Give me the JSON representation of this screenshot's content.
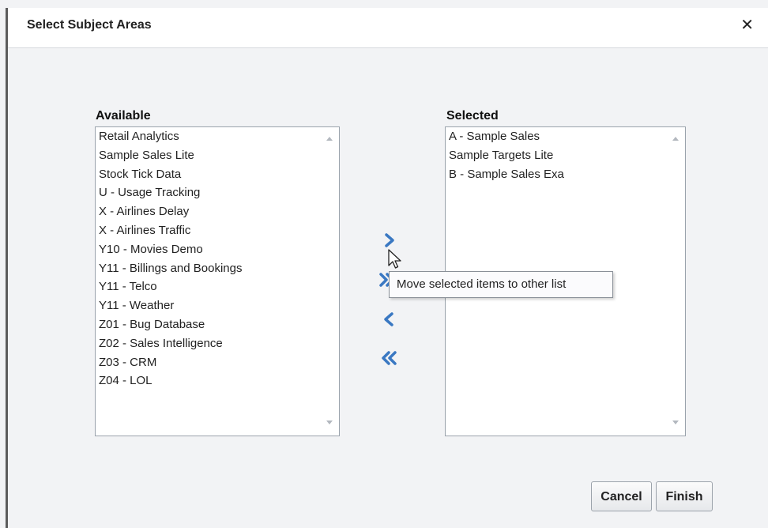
{
  "dialog": {
    "title": "Select Subject Areas",
    "close_glyph": "✕"
  },
  "available": {
    "label": "Available",
    "items": [
      "Retail Analytics",
      "Sample Sales Lite",
      "Stock Tick Data",
      "U - Usage Tracking",
      "X - Airlines Delay",
      "X - Airlines Traffic",
      "Y10 - Movies Demo",
      "Y11 - Billings and Bookings",
      "Y11 - Telco",
      "Y11 - Weather",
      "Z01 - Bug Database",
      "Z02 - Sales Intelligence",
      "Z03 - CRM",
      "Z04 - LOL"
    ]
  },
  "selected": {
    "label": "Selected",
    "items": [
      "A - Sample Sales",
      "Sample Targets Lite",
      "B - Sample Sales Exa"
    ]
  },
  "movers": {
    "tooltip": "Move selected items to other list",
    "icon_color": "#3a78c2",
    "icons": [
      "chevron-right-icon",
      "double-chevron-right-icon",
      "chevron-left-icon",
      "double-chevron-left-icon"
    ]
  },
  "buttons": {
    "cancel": "Cancel",
    "finish": "Finish"
  }
}
